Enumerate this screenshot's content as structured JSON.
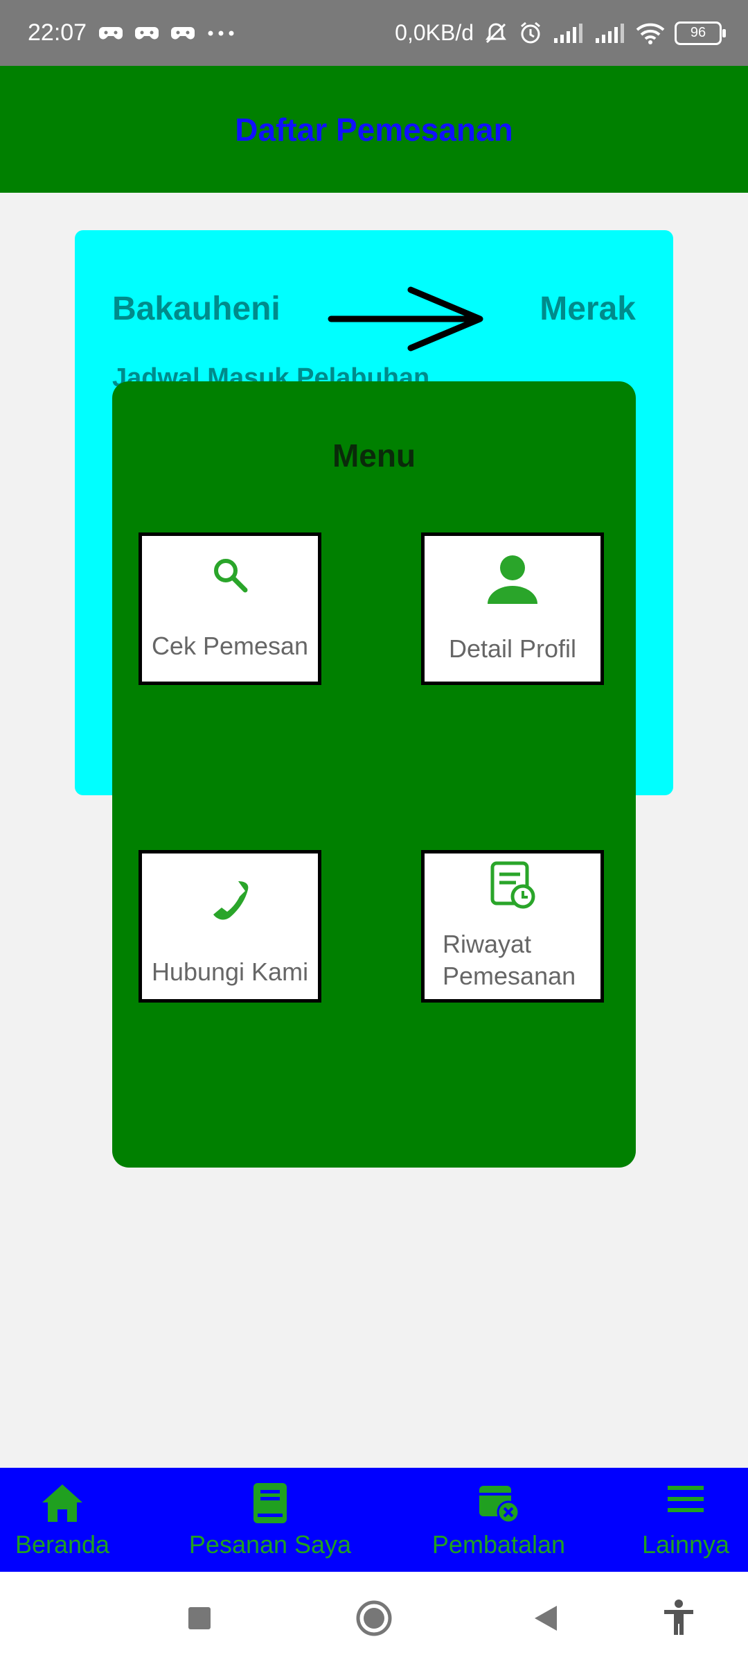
{
  "status_bar": {
    "time": "22:07",
    "network_speed": "0,0KB/d",
    "battery": "96",
    "icons": [
      "game-icon",
      "game-icon",
      "game-icon",
      "more-dots-icon",
      "mute-icon",
      "alarm-icon",
      "signal-icon",
      "signal-icon",
      "wifi-icon",
      "battery-icon"
    ]
  },
  "header": {
    "title": "Daftar Pemesanan"
  },
  "route_card": {
    "from": "Bakauheni",
    "to": "Merak",
    "subtitle": "Jadwal Masuk Pelabuhan"
  },
  "menu": {
    "title": "Menu",
    "items": [
      {
        "label": "Cek Pemesan",
        "icon": "search-icon"
      },
      {
        "label": "Detail Profil",
        "icon": "person-icon"
      },
      {
        "label": "Hubungi Kami",
        "icon": "phone-icon"
      },
      {
        "label": "Riwayat Pemesanan",
        "icon": "history-icon"
      }
    ]
  },
  "bottom_nav": {
    "items": [
      {
        "label": "Beranda",
        "icon": "home-icon"
      },
      {
        "label": "Pesanan Saya",
        "icon": "book-icon"
      },
      {
        "label": "Pembatalan",
        "icon": "cancel-calendar-icon"
      },
      {
        "label": "Lainnya",
        "icon": "menu-icon"
      }
    ]
  },
  "system_nav": [
    "recents-icon",
    "home-circle-icon",
    "back-icon",
    "accessibility-icon"
  ],
  "colors": {
    "header_bg": "#008000",
    "header_text": "#1010ff",
    "card_bg": "#00ffff",
    "card_text": "#008b8b",
    "menu_bg": "#008000",
    "icon_green": "#2aa52a",
    "bottom_nav_bg": "#0000ff"
  }
}
